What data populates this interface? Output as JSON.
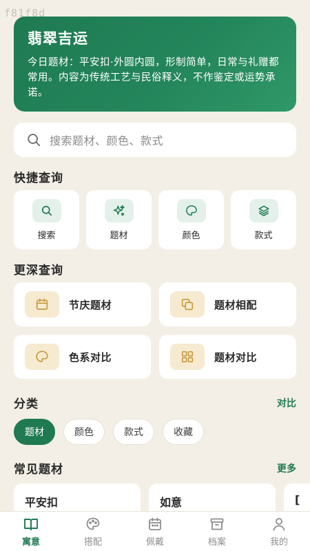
{
  "watermark": "f81f8d",
  "hero": {
    "title": "翡翠吉运",
    "desc": "今日题材：平安扣·外圆内圆，形制简单，日常与礼赠都常用。内容为传统工艺与民俗释义，不作鉴定或运势承诺。"
  },
  "search": {
    "placeholder": "搜索题材、颜色、款式",
    "icon": "search-icon"
  },
  "quick": {
    "title": "快捷查询",
    "items": [
      {
        "label": "搜索",
        "icon": "search-icon"
      },
      {
        "label": "题材",
        "icon": "sparkle-icon"
      },
      {
        "label": "颜色",
        "icon": "palette-icon"
      },
      {
        "label": "款式",
        "icon": "layers-icon"
      }
    ]
  },
  "deep": {
    "title": "更深查询",
    "items": [
      {
        "label": "节庆题材",
        "icon": "calendar-icon"
      },
      {
        "label": "题材相配",
        "icon": "copy-icon"
      },
      {
        "label": "色系对比",
        "icon": "palette-icon"
      },
      {
        "label": "题材对比",
        "icon": "grid-icon"
      }
    ]
  },
  "category": {
    "title": "分类",
    "link": "对比",
    "chips": [
      "题材",
      "颜色",
      "款式",
      "收藏"
    ],
    "active_chip": "题材"
  },
  "common": {
    "title": "常见题材",
    "link": "更多",
    "items": [
      "平安扣",
      "如意",
      "["
    ]
  },
  "tabs": [
    {
      "label": "寓意",
      "icon": "book-icon",
      "active": true
    },
    {
      "label": "搭配",
      "icon": "palette-icon",
      "active": false
    },
    {
      "label": "佩戴",
      "icon": "calendar-icon",
      "active": false
    },
    {
      "label": "档案",
      "icon": "archive-icon",
      "active": false
    },
    {
      "label": "我的",
      "icon": "user-icon",
      "active": false
    }
  ],
  "colors": {
    "accent": "#1f7a52",
    "background": "#f3efe6",
    "quick_icon_bg": "#e3f1ea",
    "deep_icon_bg": "#f6ead0",
    "deep_icon_stroke": "#c79a3e",
    "tab_inactive": "#8d8d8d"
  }
}
